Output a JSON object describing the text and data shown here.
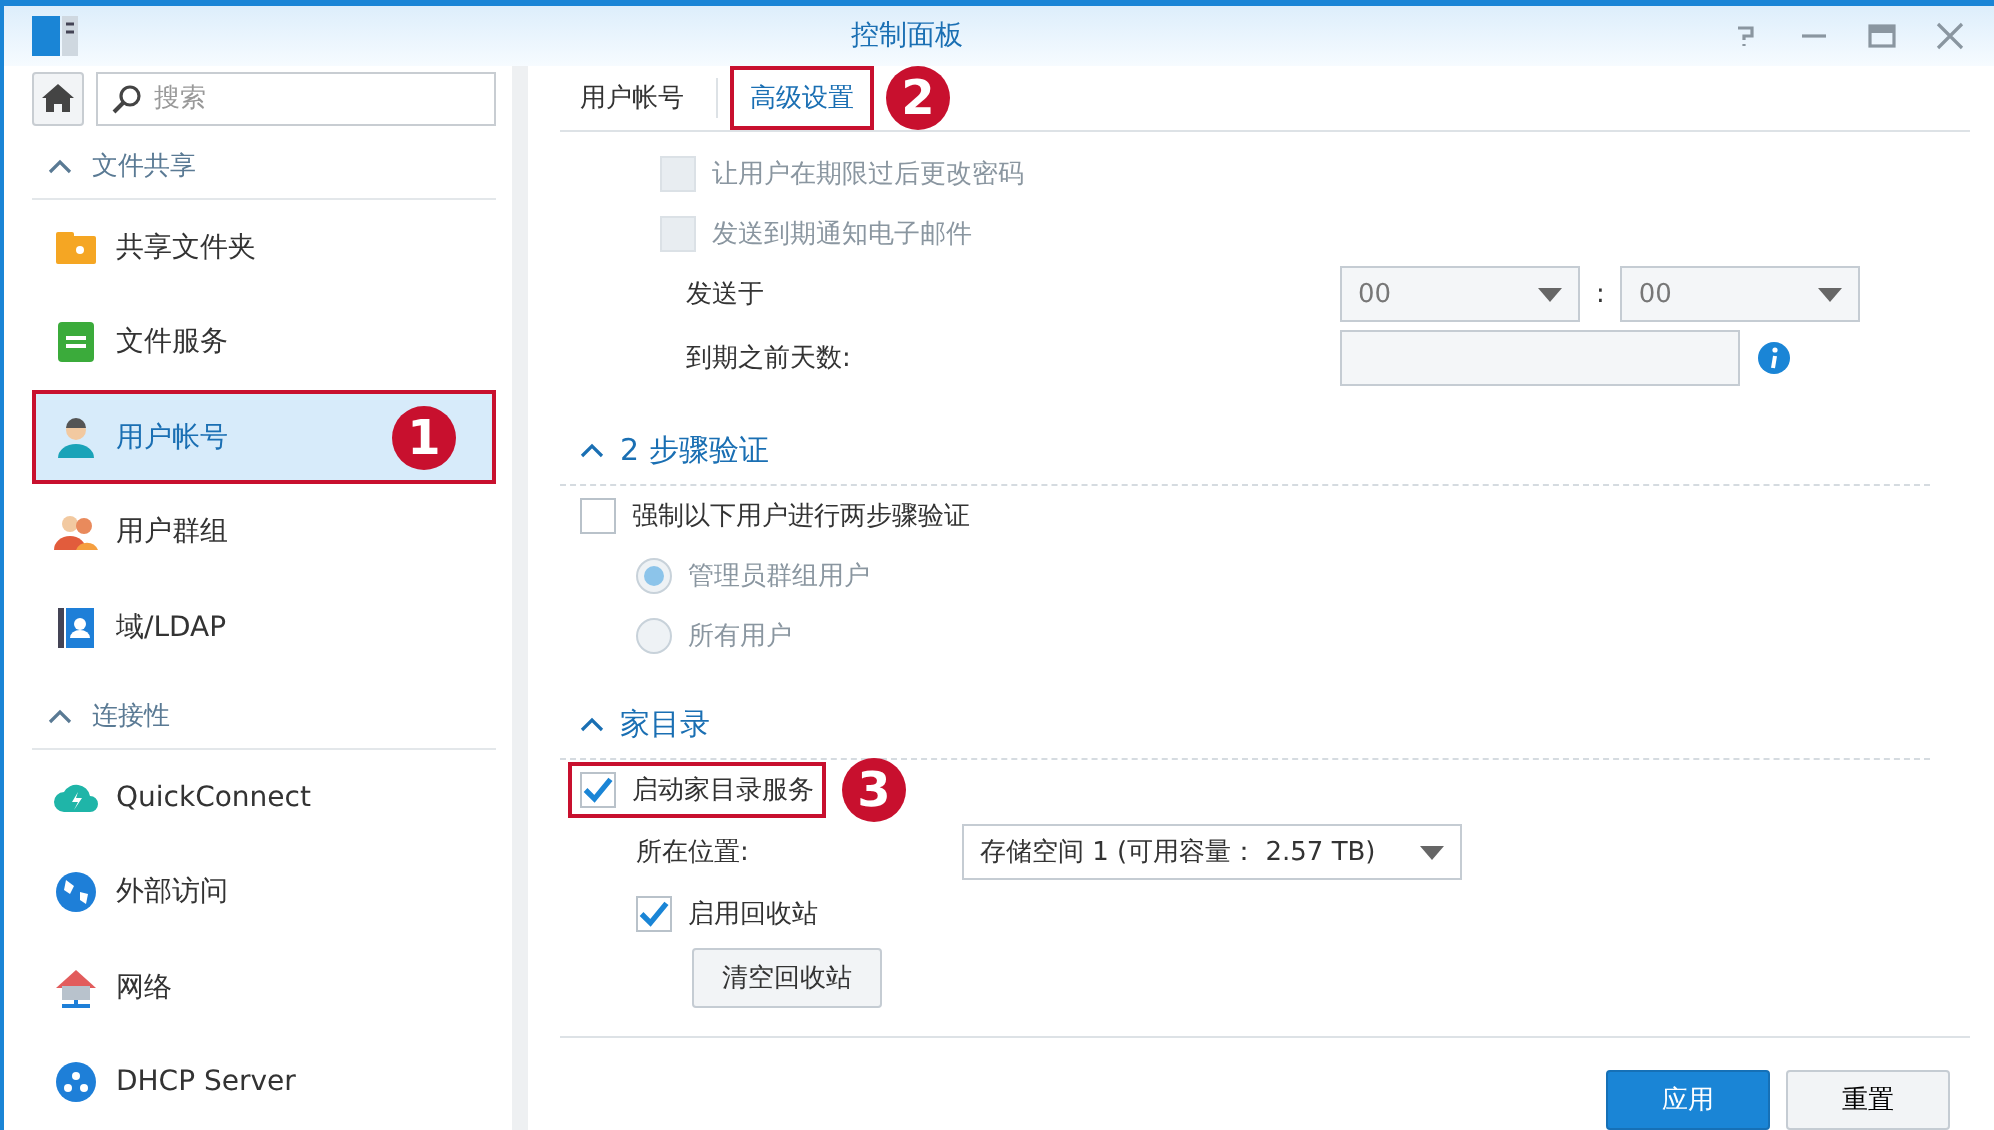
{
  "window": {
    "title": "控制面板"
  },
  "sidebar": {
    "search": {
      "placeholder": "搜索"
    },
    "sections": [
      {
        "title": "文件共享",
        "expanded": true,
        "items": [
          {
            "label": "共享文件夹",
            "kind": "folder",
            "selected": false
          },
          {
            "label": "文件服务",
            "kind": "fileservice",
            "selected": false
          },
          {
            "label": "用户帐号",
            "kind": "user",
            "selected": true,
            "callout": "1"
          },
          {
            "label": "用户群组",
            "kind": "group",
            "selected": false
          },
          {
            "label": "域/LDAP",
            "kind": "ldap",
            "selected": false
          }
        ]
      },
      {
        "title": "连接性",
        "expanded": true,
        "items": [
          {
            "label": "QuickConnect",
            "kind": "cloud",
            "selected": false
          },
          {
            "label": "外部访问",
            "kind": "globe",
            "selected": false
          },
          {
            "label": "网络",
            "kind": "network",
            "selected": false
          },
          {
            "label": "DHCP Server",
            "kind": "dhcp",
            "selected": false
          }
        ]
      }
    ]
  },
  "tabs": [
    {
      "label": "用户帐号",
      "selected": false
    },
    {
      "label": "高级设置",
      "selected": true,
      "callout": "2"
    }
  ],
  "sections": [
    {
      "rows": [
        {
          "kind": "checkbox",
          "label": "让用户在期限过后更改密码",
          "checked": false,
          "disabled": true
        },
        {
          "kind": "checkbox",
          "label": "发送到期通知电子邮件",
          "checked": false,
          "disabled": true,
          "children": [
            {
              "kind": "time",
              "label": "发送于",
              "hour": "00",
              "separator": ":",
              "minute": "00"
            },
            {
              "kind": "number",
              "label": "到期之前天数:"
            }
          ]
        }
      ]
    },
    {
      "title": "2 步骤验证",
      "expanded": true,
      "rows": [
        {
          "kind": "checkbox",
          "label": "强制以下用户进行两步骤验证",
          "checked": false,
          "disabled": false,
          "children": [
            {
              "kind": "radio",
              "label": "管理员群组用户",
              "selected": true,
              "disabled": true
            },
            {
              "kind": "radio",
              "label": "所有用户",
              "selected": false,
              "disabled": true
            }
          ]
        }
      ]
    },
    {
      "title": "家目录",
      "expanded": true,
      "rows": [
        {
          "kind": "checkbox",
          "label": "启动家目录服务",
          "checked": true,
          "disabled": false,
          "callout": "3",
          "children": [
            {
              "kind": "select",
              "label": "所在位置:",
              "value": "存储空间 1 (可用容量： 2.57 TB)"
            },
            {
              "kind": "checkbox",
              "label": "启用回收站",
              "checked": true,
              "disabled": false,
              "children": [
                {
                  "kind": "button",
                  "label": "清空回收站"
                }
              ]
            }
          ]
        }
      ]
    }
  ],
  "footer": {
    "buttons": [
      {
        "label": "应用",
        "primary": true
      },
      {
        "label": "重置",
        "primary": false
      }
    ]
  }
}
